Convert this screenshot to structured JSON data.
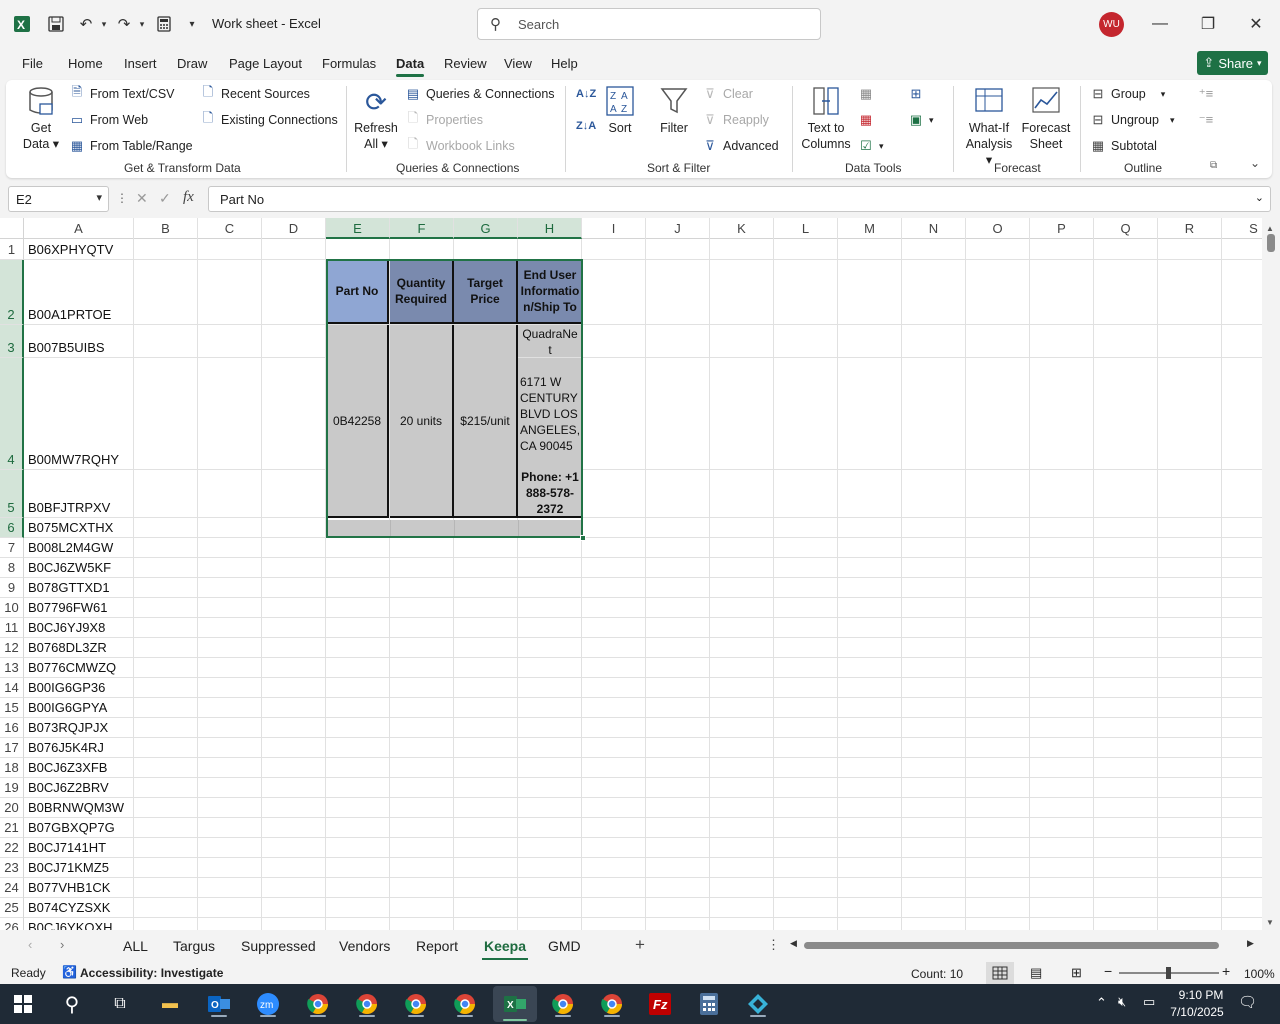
{
  "titlebar": {
    "doc_title": "Work sheet  -  Excel",
    "search_placeholder": "Search",
    "user_initials": "WU"
  },
  "menu": {
    "tabs": [
      "File",
      "Home",
      "Insert",
      "Draw",
      "Page Layout",
      "Formulas",
      "Data",
      "Review",
      "View",
      "Help"
    ],
    "active": "Data",
    "share_label": "Share"
  },
  "ribbon": {
    "get_data": {
      "get_data_label": "Get\nData",
      "from_text_csv": "From Text/CSV",
      "from_web": "From Web",
      "from_table_range": "From Table/Range",
      "recent_sources": "Recent Sources",
      "existing_connections": "Existing Connections",
      "group_label": "Get & Transform Data"
    },
    "queries": {
      "refresh_all": "Refresh\nAll",
      "queries_connections": "Queries & Connections",
      "properties": "Properties",
      "workbook_links": "Workbook Links",
      "group_label": "Queries & Connections"
    },
    "sort_filter": {
      "sort": "Sort",
      "filter": "Filter",
      "clear": "Clear",
      "reapply": "Reapply",
      "advanced": "Advanced",
      "group_label": "Sort & Filter"
    },
    "data_tools": {
      "text_to_columns": "Text to\nColumns",
      "group_label": "Data Tools"
    },
    "forecast": {
      "what_if": "What-If\nAnalysis",
      "forecast_sheet": "Forecast\nSheet",
      "group_label": "Forecast"
    },
    "outline": {
      "group": "Group",
      "ungroup": "Ungroup",
      "subtotal": "Subtotal",
      "group_label": "Outline"
    }
  },
  "formula_bar": {
    "name_box": "E2",
    "formula": "Part No"
  },
  "grid": {
    "columns": [
      "A",
      "B",
      "C",
      "D",
      "E",
      "F",
      "G",
      "H",
      "I",
      "J",
      "K",
      "L",
      "M",
      "N",
      "O",
      "P",
      "Q",
      "R",
      "S"
    ],
    "selected_columns": [
      "E",
      "F",
      "G",
      "H"
    ],
    "rows": [
      {
        "num": "1",
        "a": "B06XPHYQTV"
      },
      {
        "num": "2",
        "a": "B00A1PRTOE"
      },
      {
        "num": "3",
        "a": "B007B5UIBS"
      },
      {
        "num": "4",
        "a": "B00MW7RQHY"
      },
      {
        "num": "5",
        "a": "B0BFJTRPXV"
      },
      {
        "num": "6",
        "a": "B075MCXTHX"
      },
      {
        "num": "7",
        "a": "B008L2M4GW"
      },
      {
        "num": "8",
        "a": "B0CJ6ZW5KF"
      },
      {
        "num": "9",
        "a": "B078GTTXD1"
      },
      {
        "num": "10",
        "a": "B07796FW61"
      },
      {
        "num": "11",
        "a": "B0CJ6YJ9X8"
      },
      {
        "num": "12",
        "a": "B0768DL3ZR"
      },
      {
        "num": "13",
        "a": "B0776CMWZQ"
      },
      {
        "num": "14",
        "a": "B00IG6GP36"
      },
      {
        "num": "15",
        "a": "B00IG6GPYA"
      },
      {
        "num": "16",
        "a": "B073RQJPJX"
      },
      {
        "num": "17",
        "a": "B076J5K4RJ"
      },
      {
        "num": "18",
        "a": "B0CJ6Z3XFB"
      },
      {
        "num": "19",
        "a": "B0CJ6Z2BRV"
      },
      {
        "num": "20",
        "a": "B0BRNWQM3W"
      },
      {
        "num": "21",
        "a": "B07GBXQP7G"
      },
      {
        "num": "22",
        "a": "B0CJ7141HT"
      },
      {
        "num": "23",
        "a": "B0CJ71KMZ5"
      },
      {
        "num": "24",
        "a": "B077VHB1CK"
      },
      {
        "num": "25",
        "a": "B074CYZSXK"
      },
      {
        "num": "26",
        "a": "B0CJ6YKQXH"
      }
    ],
    "table": {
      "headers": [
        "Part No",
        "Quantity Required",
        "Target Price",
        "End User Informatio n/Ship To"
      ],
      "part_no": "0B42258",
      "quantity": "20 units",
      "price": "$215/unit",
      "ship_company": "QuadraNe t",
      "ship_address": "6171 W CENTURY BLVD LOS ANGELES, CA 90045",
      "ship_phone": "Phone: +1 888-578-2372"
    }
  },
  "sheets": {
    "tabs": [
      "ALL",
      "Targus",
      "Suppressed",
      "Vendors",
      "Report",
      "Keepa",
      "GMD"
    ],
    "active": "Keepa"
  },
  "status": {
    "ready": "Ready",
    "accessibility": "Accessibility: Investigate",
    "count": "Count: 10",
    "zoom": "100%"
  },
  "taskbar": {
    "time": "9:10 PM",
    "date": "7/10/2025"
  },
  "colors": {
    "excel_green": "#1e7145",
    "header_blue": "#8fa6d3",
    "header_slate": "#7a8aae",
    "cell_gray": "#c9c9c9"
  }
}
